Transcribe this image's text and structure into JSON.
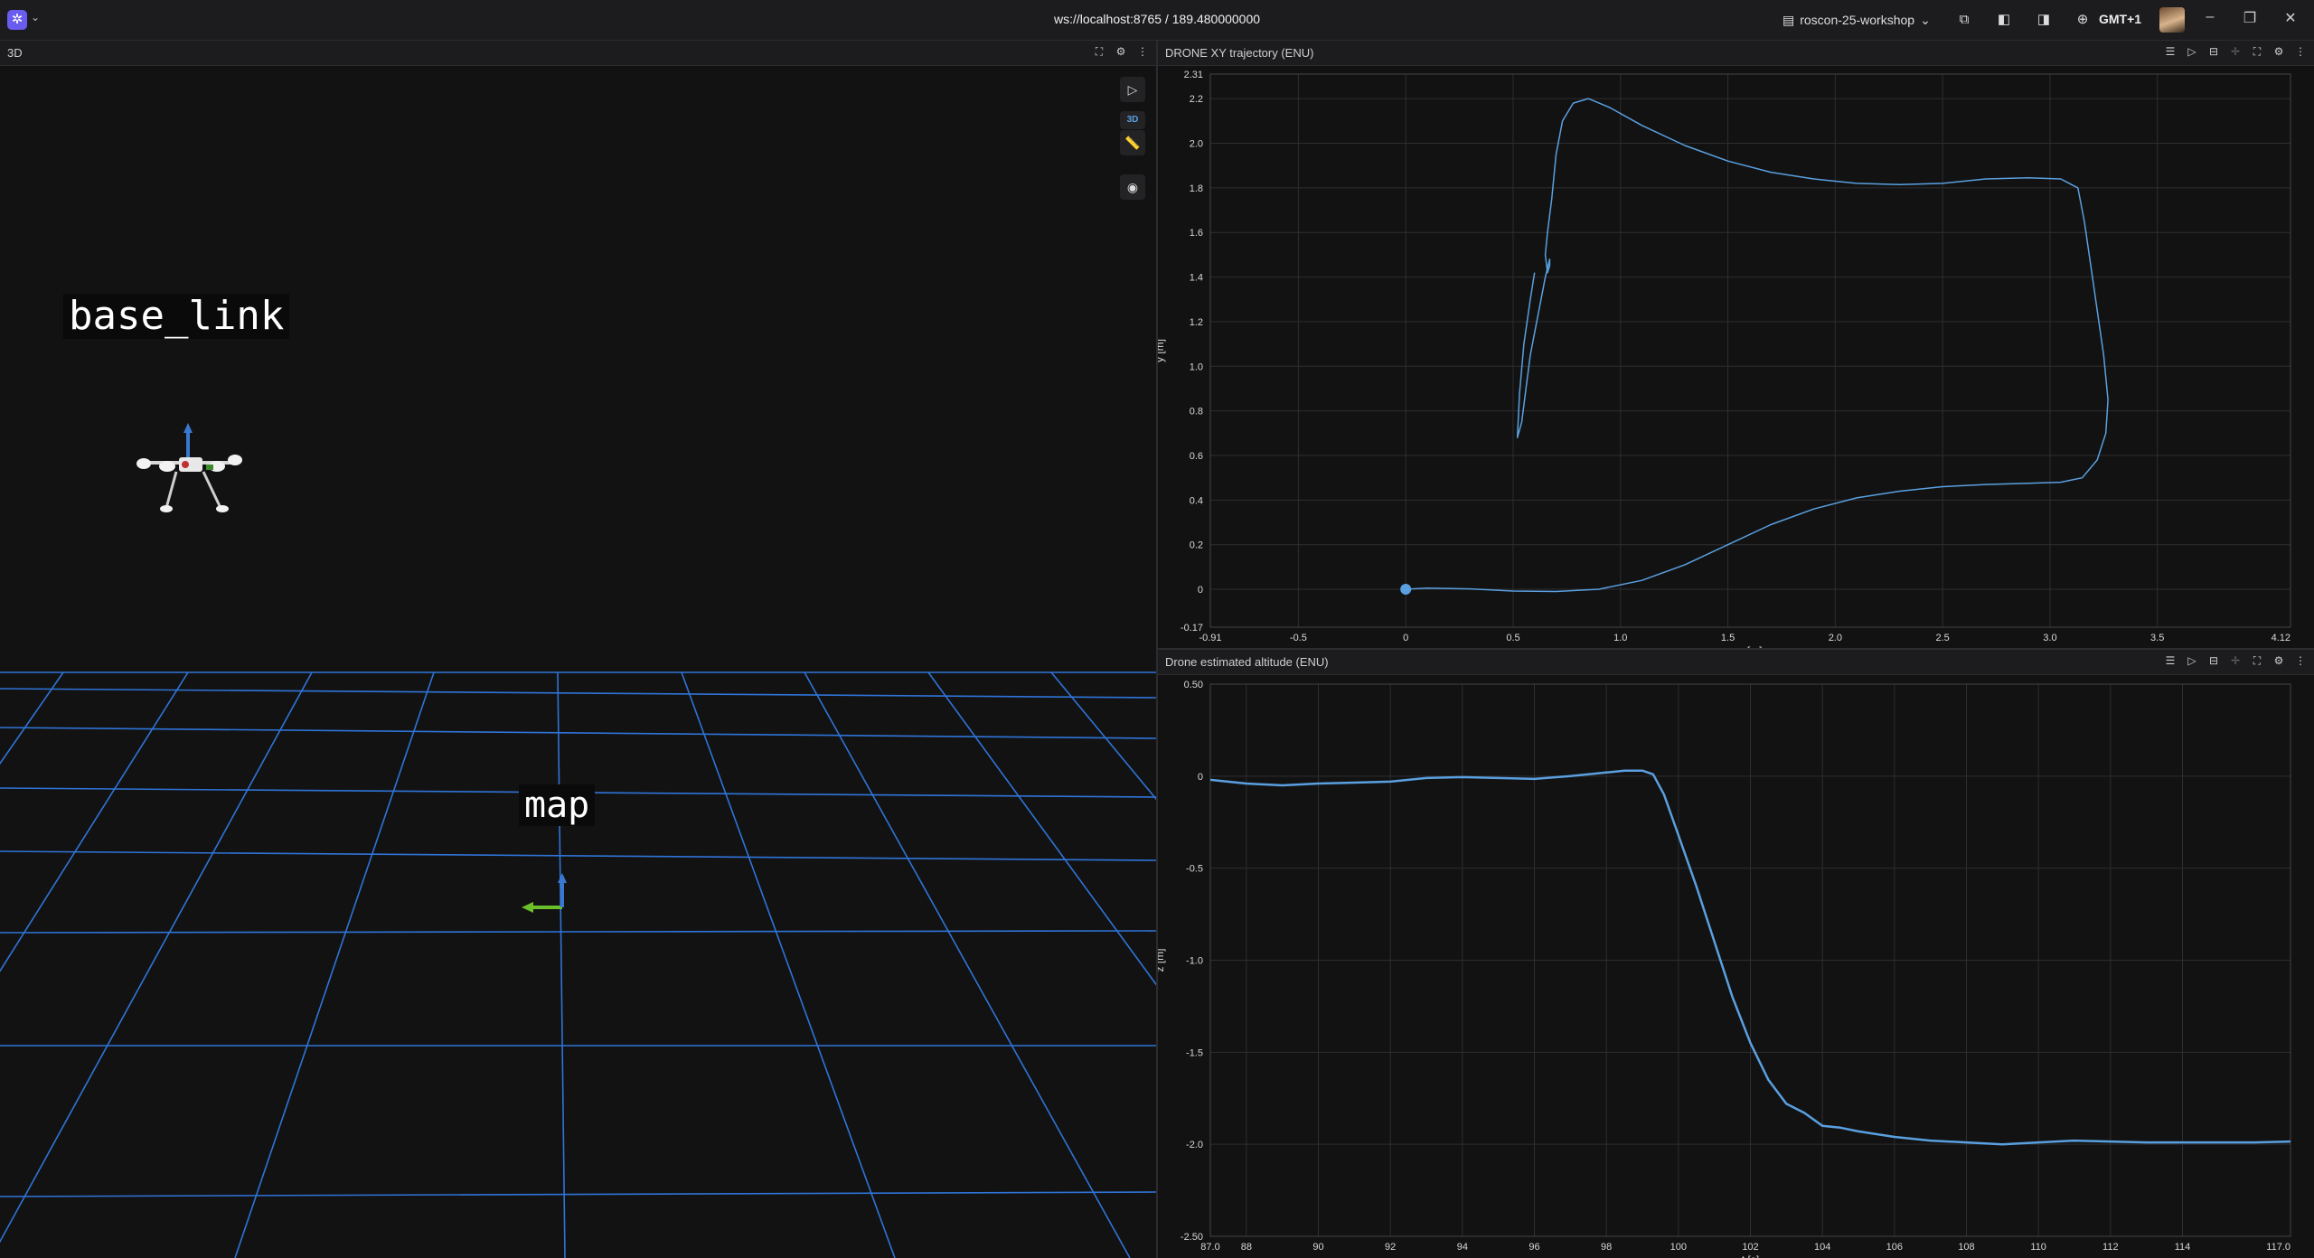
{
  "topbar": {
    "connection": "ws://localhost:8765 / 189.480000000",
    "layout_name": "roscon-25-workshop",
    "timezone": "GMT+1"
  },
  "scene3d": {
    "title": "3D",
    "tool_3d_label": "3D",
    "frame_labels": [
      "base_link",
      "map"
    ]
  },
  "xy_panel": {
    "title": "DRONE XY trajectory (ENU)",
    "chart_data": {
      "type": "line",
      "xlabel": "x [m]",
      "ylabel": "y [m]",
      "xlim": [
        -0.91,
        4.12
      ],
      "ylim": [
        -0.17,
        2.31
      ],
      "x_ticks": [
        "-0.91",
        "-0.5",
        "0",
        "0.5",
        "1.0",
        "1.5",
        "2.0",
        "2.5",
        "3.0",
        "3.5",
        "4.12"
      ],
      "y_ticks": [
        "-0.17",
        "0",
        "0.2",
        "0.4",
        "0.6",
        "0.8",
        "1.0",
        "1.2",
        "1.4",
        "1.6",
        "1.8",
        "2.0",
        "2.2",
        "2.31"
      ],
      "series": [
        {
          "color": "#5aa0e0",
          "x": [
            0,
            0.1,
            0.3,
            0.5,
            0.7,
            0.9,
            1.1,
            1.3,
            1.5,
            1.7,
            1.9,
            2.1,
            2.3,
            2.5,
            2.7,
            2.9,
            3.05,
            3.15,
            3.22,
            3.26,
            3.27,
            3.25,
            3.22,
            3.19,
            3.16,
            3.13,
            3.05,
            2.9,
            2.7,
            2.5,
            2.3,
            2.1,
            1.9,
            1.7,
            1.5,
            1.3,
            1.1,
            0.95,
            0.85,
            0.78,
            0.73,
            0.7,
            0.68,
            0.66,
            0.65,
            0.66,
            0.67,
            0.67,
            0.65,
            0.63,
            0.61,
            0.58,
            0.56,
            0.54,
            0.52,
            0.53,
            0.55,
            0.58,
            0.6
          ],
          "y": [
            0,
            0.005,
            0.002,
            -0.008,
            -0.01,
            0.0,
            0.04,
            0.11,
            0.2,
            0.29,
            0.36,
            0.41,
            0.44,
            0.46,
            0.47,
            0.475,
            0.48,
            0.5,
            0.58,
            0.7,
            0.85,
            1.05,
            1.25,
            1.45,
            1.65,
            1.8,
            1.84,
            1.845,
            1.84,
            1.82,
            1.815,
            1.82,
            1.84,
            1.87,
            1.92,
            1.99,
            2.08,
            2.16,
            2.2,
            2.18,
            2.1,
            1.95,
            1.75,
            1.6,
            1.5,
            1.42,
            1.45,
            1.48,
            1.4,
            1.3,
            1.2,
            1.05,
            0.9,
            0.75,
            0.68,
            0.88,
            1.1,
            1.3,
            1.42
          ]
        }
      ]
    }
  },
  "z_panel": {
    "title": "Drone estimated altitude (ENU)",
    "chart_data": {
      "type": "line",
      "xlabel": "t [s]",
      "ylabel": "z [m]",
      "xlim": [
        87.0,
        117.0
      ],
      "ylim": [
        -2.5,
        0.5
      ],
      "x_ticks": [
        "87.0",
        "88",
        "90",
        "92",
        "94",
        "96",
        "98",
        "100",
        "102",
        "104",
        "106",
        "108",
        "110",
        "112",
        "114",
        "117.0"
      ],
      "y_ticks": [
        "0.50",
        "0",
        "-0.5",
        "-1.0",
        "-1.5",
        "-2.0",
        "-2.50"
      ],
      "series": [
        {
          "color": "#5aa0e0",
          "x": [
            87.0,
            88,
            89,
            90,
            91,
            92,
            93,
            94,
            95,
            96,
            97,
            98,
            98.5,
            99,
            99.3,
            99.6,
            100,
            100.5,
            101,
            101.5,
            102,
            102.5,
            103,
            103.5,
            104,
            104.5,
            105,
            106,
            107,
            108,
            109,
            110,
            111,
            112,
            113,
            114,
            115,
            116,
            117.0
          ],
          "y": [
            -0.02,
            -0.04,
            -0.05,
            -0.04,
            -0.035,
            -0.03,
            -0.01,
            -0.005,
            -0.01,
            -0.015,
            0.0,
            0.02,
            0.03,
            0.03,
            0.01,
            -0.1,
            -0.32,
            -0.6,
            -0.9,
            -1.2,
            -1.45,
            -1.65,
            -1.78,
            -1.83,
            -1.9,
            -1.91,
            -1.93,
            -1.96,
            -1.98,
            -1.99,
            -2.0,
            -1.99,
            -1.98,
            -1.985,
            -1.99,
            -1.99,
            -1.99,
            -1.99,
            -1.985
          ]
        }
      ]
    }
  }
}
